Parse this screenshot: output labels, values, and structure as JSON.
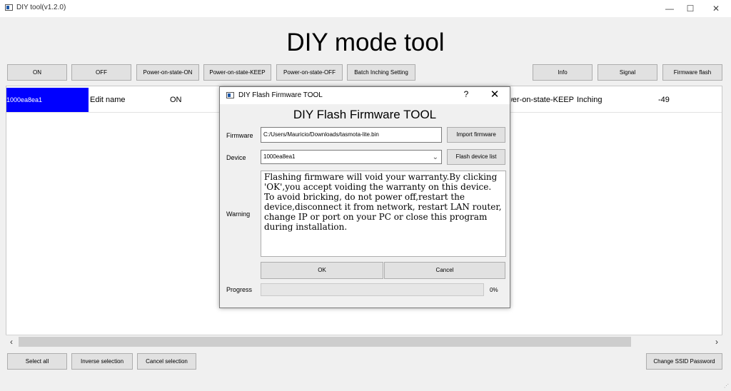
{
  "window": {
    "title": "DIY tool(v1.2.0)",
    "minimize": "—",
    "maximize": "☐",
    "close": "✕"
  },
  "main_title": "DIY mode tool",
  "toolbar": {
    "on": "ON",
    "off": "OFF",
    "power_on_state_on": "Power-on-state-ON",
    "power_on_state_keep": "Power-on-state-KEEP",
    "power_on_state_off": "Power-on-state-OFF",
    "batch_inching": "Batch Inching Setting",
    "info": "Info",
    "signal": "Signal",
    "firmware_flash": "Firmware flash"
  },
  "table": {
    "row": {
      "device_id": "1000ea8ea1",
      "name": "Edit name",
      "state": "ON",
      "power_on_state": "Power-on-state-KEEP",
      "mode": "Inching",
      "signal": "-49"
    }
  },
  "scroll": {
    "left": "‹",
    "right": "›"
  },
  "footer": {
    "select_all": "Select all",
    "inverse_selection": "Inverse selection",
    "cancel_selection": "Cancel selection",
    "change_ssid": "Change SSID Password"
  },
  "dialog": {
    "title": "DIY Flash Firmware TOOL",
    "help": "?",
    "close": "✕",
    "heading": "DIY Flash Firmware TOOL",
    "firmware_label": "Firmware",
    "firmware_path": "C:/Users/Mauricio/Downloads/tasmota-lite.bin",
    "import_button": "Import firmware",
    "device_label": "Device",
    "device_value": "1000ea8ea1",
    "flash_device_list": "Flash device list",
    "warning_label": "Warning",
    "warning_text": "Flashing firmware will void your warranty.By clicking 'OK',you accept voiding the warranty on this device. To avoid bricking, do not power off,restart the device,disconnect it from network, restart LAN router, change IP or port on your PC or close this program during installation.",
    "ok": "OK",
    "cancel": "Cancel",
    "progress_label": "Progress",
    "progress_percent": "0%",
    "progress_value": 0
  }
}
